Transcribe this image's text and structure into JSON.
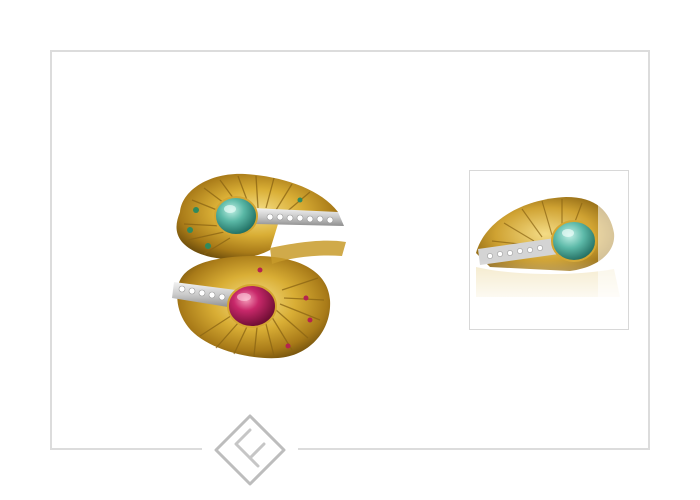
{
  "gallery": {
    "main_image": {
      "icon": "ring-emerald-ruby-image",
      "alt": ""
    },
    "thumbnail": {
      "icon": "ring-emerald-closeup-image"
    }
  },
  "brand": {
    "logo_icon": "diamond-logo-icon"
  },
  "colors": {
    "frame_border": "#dcdcdc",
    "logo_stroke": "#bdbdbd",
    "gold": "#d6a82c",
    "emerald": "#4fa99b",
    "ruby": "#c0265a"
  }
}
